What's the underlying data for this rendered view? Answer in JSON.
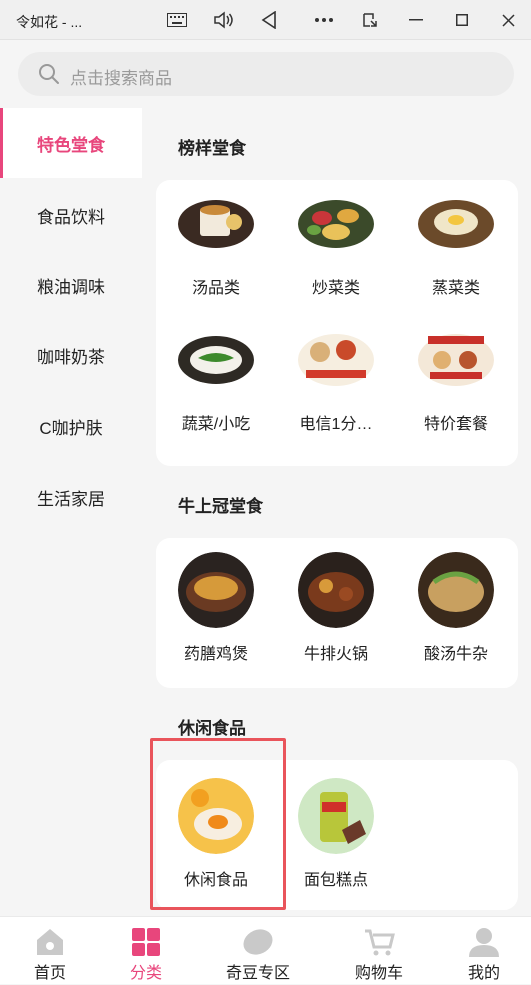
{
  "window": {
    "title": "令如花 - ..."
  },
  "titlebar_icons": [
    "keyboard-icon",
    "volume-icon",
    "back-triangle-icon",
    "more-dots-icon",
    "screen-rotate-icon",
    "minimize-icon",
    "maximize-icon",
    "close-icon"
  ],
  "search": {
    "placeholder": "点击搜索商品"
  },
  "sidebar": {
    "items": [
      {
        "label": "特色堂食",
        "active": true
      },
      {
        "label": "食品饮料"
      },
      {
        "label": "粮油调味"
      },
      {
        "label": "咖啡奶茶"
      },
      {
        "label": "C咖护肤"
      },
      {
        "label": "生活家居"
      }
    ]
  },
  "sections": [
    {
      "title": "榜样堂食",
      "items": [
        {
          "label": "汤品类"
        },
        {
          "label": "炒菜类"
        },
        {
          "label": "蒸菜类"
        },
        {
          "label": "蔬菜/小吃"
        },
        {
          "label": "电信1分…"
        },
        {
          "label": "特价套餐"
        }
      ]
    },
    {
      "title": "牛上冠堂食",
      "items": [
        {
          "label": "药膳鸡煲"
        },
        {
          "label": "牛排火锅"
        },
        {
          "label": "酸汤牛杂"
        }
      ]
    },
    {
      "title": "休闲食品",
      "items": [
        {
          "label": "休闲食品"
        },
        {
          "label": "面包糕点"
        }
      ]
    }
  ],
  "tabbar": {
    "tabs": [
      {
        "label": "首页"
      },
      {
        "label": "分类",
        "active": true
      },
      {
        "label": "奇豆专区"
      },
      {
        "label": "购物车"
      },
      {
        "label": "我的"
      }
    ]
  },
  "colors": {
    "accent": "#e8467c",
    "highlight_box": "#e9545b"
  }
}
